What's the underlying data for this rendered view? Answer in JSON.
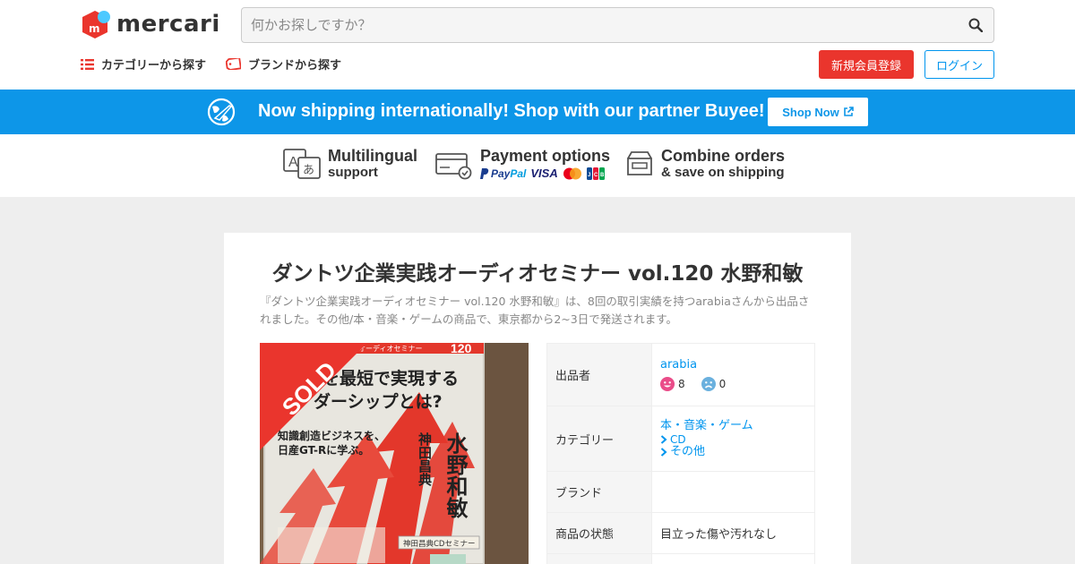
{
  "header": {
    "logo_text": "mercari",
    "search_placeholder": "何かお探しですか？",
    "nav": [
      {
        "label": "カテゴリーから探す",
        "icon": "list-icon"
      },
      {
        "label": "ブランドから探す",
        "icon": "tag-icon"
      }
    ],
    "register_label": "新規会員登録",
    "login_label": "ログイン"
  },
  "banner": {
    "text": "Now shipping internationally! Shop with our partner Buyee!",
    "button_label": "Shop Now"
  },
  "features": [
    {
      "title": "Multilingual",
      "subtitle": "support",
      "icon": "translate-icon"
    },
    {
      "title": "Payment options",
      "logos": [
        "PayPal",
        "VISA",
        "mastercard",
        "JCB"
      ],
      "icon": "credit-card-icon"
    },
    {
      "title": "Combine orders",
      "subtitle": "& save on shipping",
      "icon": "box-icon"
    }
  ],
  "item": {
    "title": "ダントツ企業実践オーディオセミナー vol.120 水野和敏",
    "description": "『ダントツ企業実践オーディオセミナー vol.120 水野和敏』は、8回の取引実績を持つarabiaさんから出品されました。その他/本・音楽・ゲームの商品で、東京都から2~3日で発送されます。",
    "sold_label": "SOLD",
    "photo_text": {
      "series": "オーディオセミナー",
      "number": "120",
      "headline1": "を最短で実現する",
      "headline2": "ダーシップとは?",
      "tagline1": "知識創造ビジネスを、",
      "tagline2": "日産GT-Rに学ぶ。",
      "author_big": "水野和敏",
      "author_small": "神田昌典",
      "footer": "神田昌典CDセミナー"
    },
    "details": {
      "seller_label": "出品者",
      "seller_name": "arabia",
      "good_count": "8",
      "bad_count": "0",
      "category_label": "カテゴリー",
      "category_main": "本・音楽・ゲーム",
      "category_sub1": "CD",
      "category_sub2": "その他",
      "brand_label": "ブランド",
      "brand_value": "",
      "condition_label": "商品の状態",
      "condition_value": "目立った傷や汚れなし"
    }
  },
  "colors": {
    "brand_red": "#ea352d",
    "accent_blue": "#0095ee",
    "banner_blue": "#0d96e8"
  }
}
